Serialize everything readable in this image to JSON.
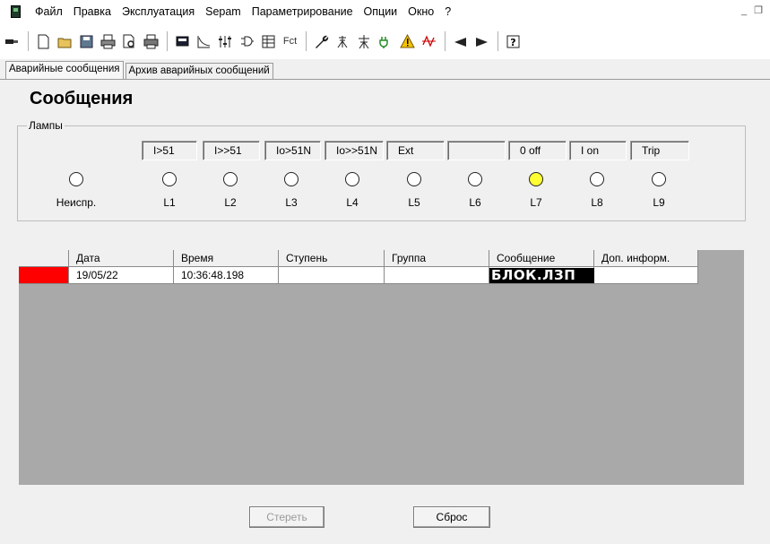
{
  "menubar": {
    "items": [
      "Файл",
      "Правка",
      "Эксплуатация",
      "Sepam",
      "Параметрирование",
      "Опции",
      "Окно",
      "?"
    ]
  },
  "toolbar": {
    "fct_label": "Fct",
    "icons": [
      "connect-icon",
      "new-icon",
      "open-icon",
      "save-icon",
      "print-icon",
      "print-preview-icon",
      "printer-setup-icon",
      "display-icon",
      "curve-icon",
      "settings-icon",
      "logic-icon",
      "table-icon",
      "fct-icon",
      "wrench-icon",
      "antenna-icon",
      "tower-icon",
      "plug-icon",
      "warning-icon",
      "waveform-icon",
      "prev-icon",
      "next-icon",
      "help-icon"
    ]
  },
  "tabs": [
    {
      "label": "Аварийные сообщения",
      "active": true
    },
    {
      "label": "Архив аварийных сообщений",
      "active": false
    }
  ],
  "page_title": "Сообщения",
  "lamps": {
    "legend": "Лампы",
    "labels": [
      "I>51",
      "I>>51",
      "Io>51N",
      "Io>>51N",
      "Ext",
      "",
      "0 off",
      "I on",
      "Trip"
    ],
    "names": [
      "Неиспр.",
      "L1",
      "L2",
      "L3",
      "L4",
      "L5",
      "L6",
      "L7",
      "L8",
      "L9"
    ],
    "states": [
      "off",
      "off",
      "off",
      "off",
      "off",
      "off",
      "off",
      "on",
      "off",
      "off"
    ],
    "on_color": "#ffff33"
  },
  "table": {
    "headers": [
      "",
      "Дата",
      "Время",
      "Ступень",
      "Группа",
      "Сообщение",
      "Доп. информ."
    ],
    "rows": [
      {
        "indicator_color": "#ff0000",
        "date": "19/05/22",
        "time": "10:36:48.198",
        "stage": "",
        "group": "",
        "message": "БЛОК.ЛЗП",
        "extra": ""
      }
    ]
  },
  "buttons": {
    "clear_label": "Стереть",
    "reset_label": "Сброс"
  }
}
